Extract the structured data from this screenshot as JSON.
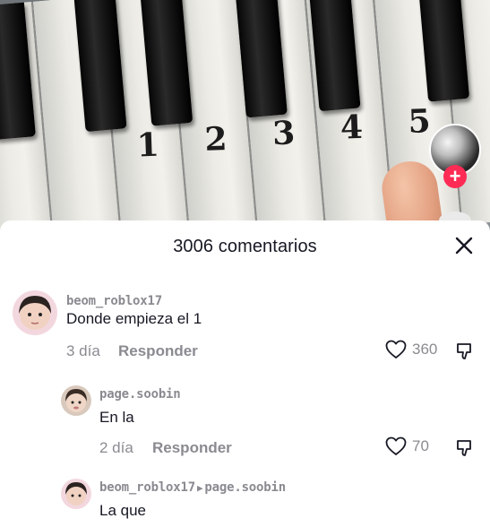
{
  "video": {
    "key_numbers": [
      "1",
      "2",
      "3",
      "4",
      "5"
    ],
    "follow_icon": "plus-icon"
  },
  "comments_sheet": {
    "title": "3006 comentarios",
    "close_icon": "close-icon"
  },
  "comments": [
    {
      "username": "beom_roblox17",
      "text": "Donde empieza el 1",
      "date": "3 día",
      "reply_label": "Responder",
      "likes": "360"
    },
    {
      "username": "page.soobin",
      "text": "En la",
      "date": "2 día",
      "reply_label": "Responder",
      "likes": "70"
    },
    {
      "username": "beom_roblox17",
      "reply_to": "page.soobin",
      "text": "La que"
    }
  ],
  "colors": {
    "accent": "#fe2c55",
    "muted_text": "#8a8b91",
    "primary_text": "#161823"
  }
}
